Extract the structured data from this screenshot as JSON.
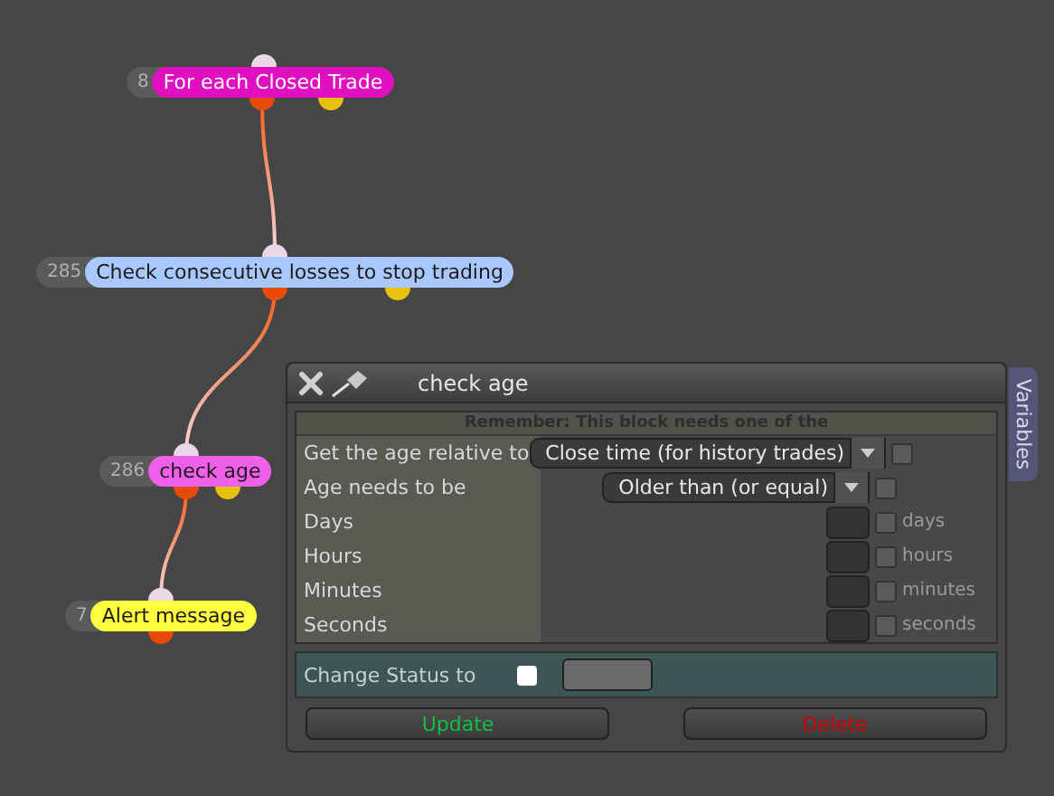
{
  "nodes": [
    {
      "number": "8",
      "label": "For each Closed Trade",
      "color": "#e010c0",
      "second_output": true
    },
    {
      "number": "285",
      "label": "Check consecutive losses to stop trading",
      "color": "#a8c8ff",
      "second_output": true
    },
    {
      "number": "286",
      "label": "check age",
      "color": "#f060e8",
      "second_output": true
    },
    {
      "number": "7",
      "label": "Alert message",
      "color": "#ffff40",
      "second_output": false
    }
  ],
  "dialog": {
    "title": "check age",
    "side_tab": "Variables",
    "notice": "Remember: This block needs one of the",
    "rows": [
      {
        "kind": "dropdown",
        "label": "Get the age relative to",
        "value": "Close time (for history trades)",
        "checked": false
      },
      {
        "kind": "dropdown",
        "label": "Age needs to be",
        "value": "Older than (or equal)",
        "checked": false
      },
      {
        "kind": "number",
        "label": "Days",
        "unit": "days",
        "checked": false
      },
      {
        "kind": "number",
        "label": "Hours",
        "unit": "hours",
        "checked": false
      },
      {
        "kind": "number",
        "label": "Minutes",
        "unit": "minutes",
        "checked": false
      },
      {
        "kind": "number",
        "label": "Seconds",
        "unit": "seconds",
        "checked": false
      }
    ],
    "status": {
      "label": "Change Status to",
      "checked": false
    },
    "buttons": [
      {
        "label": "Update",
        "kind": "update"
      },
      {
        "label": "Delete",
        "kind": "delete"
      }
    ]
  }
}
